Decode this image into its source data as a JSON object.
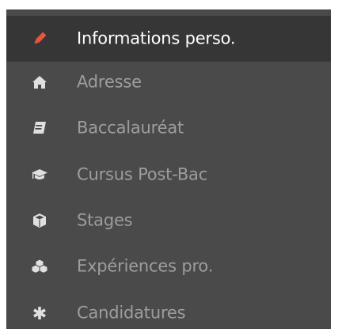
{
  "menu": {
    "items": [
      {
        "label": "Informations perso.",
        "icon": "pencil-icon",
        "active": true
      },
      {
        "label": "Adresse",
        "icon": "home-icon",
        "active": false
      },
      {
        "label": "Baccalauréat",
        "icon": "book-icon",
        "active": false
      },
      {
        "label": "Cursus Post-Bac",
        "icon": "graduation-cap-icon",
        "active": false
      },
      {
        "label": "Stages",
        "icon": "cube-icon",
        "active": false
      },
      {
        "label": "Expériences pro.",
        "icon": "cubes-icon",
        "active": false
      },
      {
        "label": "Candidatures",
        "icon": "asterisk-icon",
        "active": false
      }
    ]
  },
  "colors": {
    "menu_background": "#4a4a4a",
    "active_background": "#363636",
    "active_icon": "#e8553d",
    "active_text": "#ffffff",
    "inactive_text": "#9d9d9d",
    "inactive_icon": "#e0e0e0"
  }
}
